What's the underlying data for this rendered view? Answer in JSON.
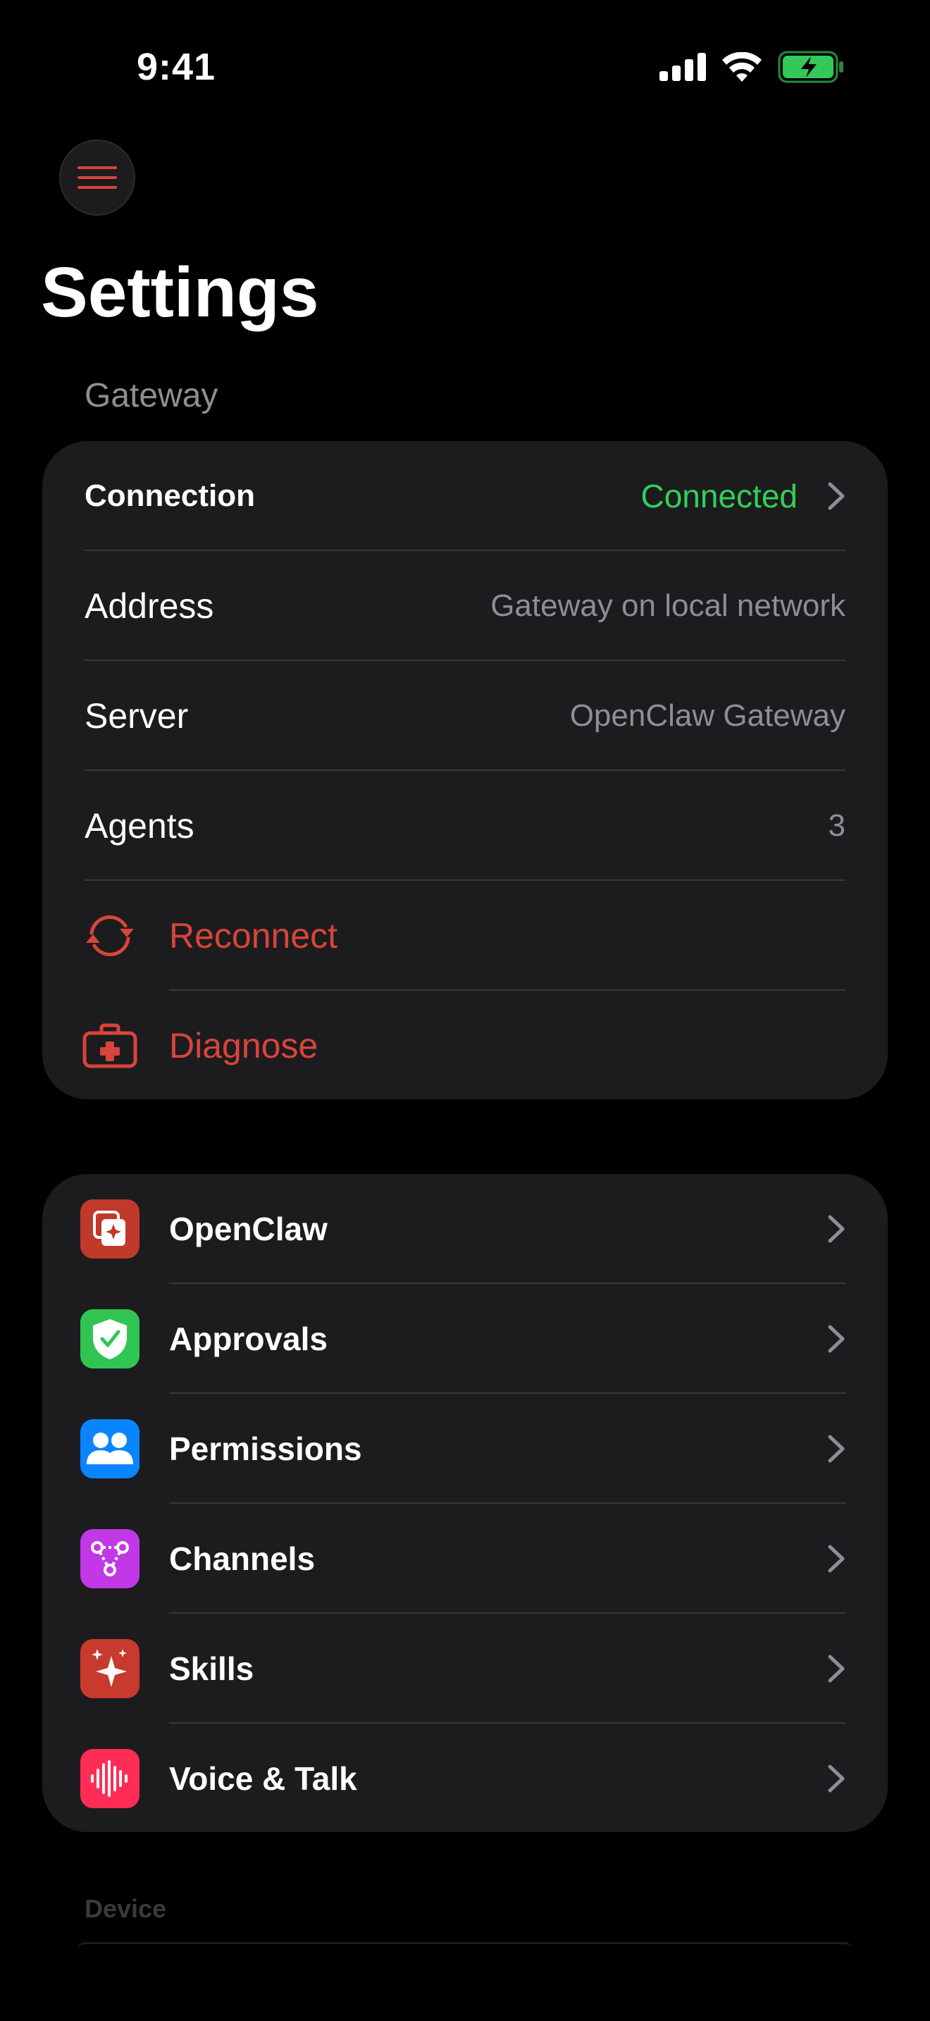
{
  "status_bar": {
    "time": "9:41",
    "icons": [
      "cellular-signal-icon",
      "wifi-icon",
      "battery-charging-icon"
    ]
  },
  "header": {
    "menu_icon": "hamburger-menu-icon",
    "title": "Settings"
  },
  "gateway_section": {
    "title": "Gateway",
    "rows": [
      {
        "label": "Connection",
        "value": "Connected",
        "value_color": "#30d158",
        "chevron": true
      },
      {
        "label": "Address",
        "value": "Gateway on local network"
      },
      {
        "label": "Server",
        "value": "OpenClaw Gateway"
      },
      {
        "label": "Agents",
        "value": "3"
      }
    ],
    "actions": [
      {
        "label": "Reconnect",
        "icon": "reconnect-icon"
      },
      {
        "label": "Diagnose",
        "icon": "first-aid-kit-icon"
      }
    ]
  },
  "apps_section": {
    "rows": [
      {
        "label": "OpenClaw",
        "icon": "openclaw-icon",
        "icon_bg": "#c0392b"
      },
      {
        "label": "Approvals",
        "icon": "shield-check-icon",
        "icon_bg": "#30c552"
      },
      {
        "label": "Permissions",
        "icon": "people-icon",
        "icon_bg": "#0a84ff"
      },
      {
        "label": "Channels",
        "icon": "channels-icon",
        "icon_bg": "#c238e6"
      },
      {
        "label": "Skills",
        "icon": "sparkles-icon",
        "icon_bg": "#c8392e"
      },
      {
        "label": "Voice & Talk",
        "icon": "waveform-icon",
        "icon_bg": "#ff2d55"
      }
    ]
  },
  "device_section": {
    "title": "Device"
  },
  "colors": {
    "accent_red": "#d9443a",
    "connected_green": "#30d158",
    "card_bg": "#1c1c1e",
    "secondary_text": "#8e8e93"
  }
}
